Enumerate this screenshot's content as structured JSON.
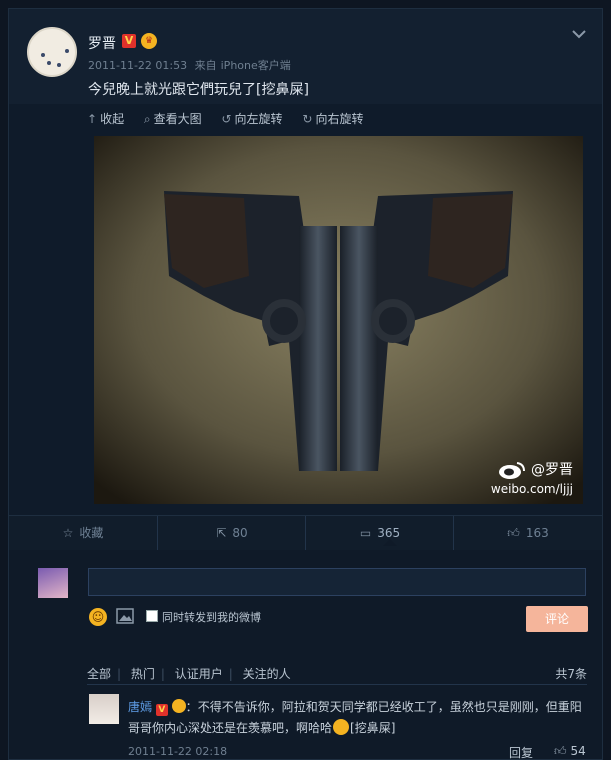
{
  "post": {
    "username": "罗晋",
    "verified_badge": "V",
    "timestamp": "2011-11-22 01:53",
    "source_prefix": "来自",
    "source": "iPhone客户端",
    "text": "今兒晚上就光跟它們玩兒了[挖鼻屎]"
  },
  "media_tools": {
    "collapse": "收起",
    "view_large": "查看大图",
    "rotate_left": "向左旋转",
    "rotate_right": "向右旋转"
  },
  "watermark": {
    "handle": "@罗晋",
    "url": "weibo.com/ljjj"
  },
  "actions": {
    "favorite": "收藏",
    "repost_count": "80",
    "comment_count": "365",
    "like_count": "163"
  },
  "comment_box": {
    "placeholder": "",
    "also_repost": "同时转发到我的微博",
    "submit": "评论"
  },
  "filters": {
    "all": "全部",
    "hot": "热门",
    "verified": "认证用户",
    "following": "关注的人",
    "total": "共7条"
  },
  "comment": {
    "author": "唐嫣",
    "badge": "V",
    "sep": "：",
    "text_part1": "不得不告诉你，阿拉和贺天同学都已经收工了，虽然也只是刚刚，但重阳哥哥你内心深处还是在羡慕吧，啊哈哈",
    "text_part2": "[挖鼻屎]",
    "time": "2011-11-22 02:18",
    "reply": "回复",
    "likes": "54"
  },
  "colors": {
    "background": "#0e1622",
    "card": "#132030",
    "link": "#5f9ee8",
    "submit_button": "#f5b59b",
    "verified_red": "#e0312b"
  }
}
